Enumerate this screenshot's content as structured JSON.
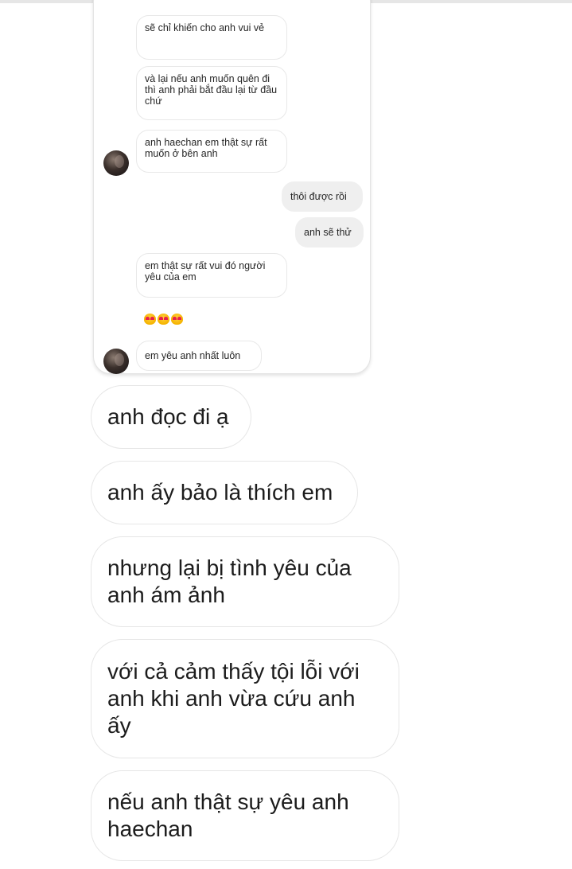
{
  "embedded_chat": {
    "messages": [
      {
        "text": "sẽ chỉ khiến cho anh vui vẻ",
        "side": "in"
      },
      {
        "text": "và lại nếu anh muốn quên đi thì anh phải bắt đầu lại từ đầu chứ",
        "side": "in"
      },
      {
        "text": "anh haechan em thật sự rất muốn ở bên anh",
        "side": "in"
      },
      {
        "text": "thôi được rồi",
        "side": "out"
      },
      {
        "text": "anh sẽ thử",
        "side": "out"
      },
      {
        "text": "em thật sự rất vui đó người yêu của em",
        "side": "in"
      },
      {
        "emoji": "heart-eyes-emoji",
        "count": 3,
        "side": "in"
      },
      {
        "text": "em yêu anh nhất luôn",
        "side": "in"
      }
    ]
  },
  "messages": [
    {
      "text": "anh đọc đi ạ"
    },
    {
      "text": "anh ấy bảo là thích em"
    },
    {
      "text": "nhưng lại bị tình yêu của anh ám ảnh"
    },
    {
      "text": "với cả cảm thấy tội lỗi với anh khi anh vừa cứu anh ấy"
    },
    {
      "text": "nếu anh thật sự yêu anh haechan"
    }
  ],
  "colors": {
    "background": "#ffffff",
    "bubble_border": "#e6e6e6",
    "outgoing_bubble": "#efefef",
    "text": "#1c1c1c"
  }
}
